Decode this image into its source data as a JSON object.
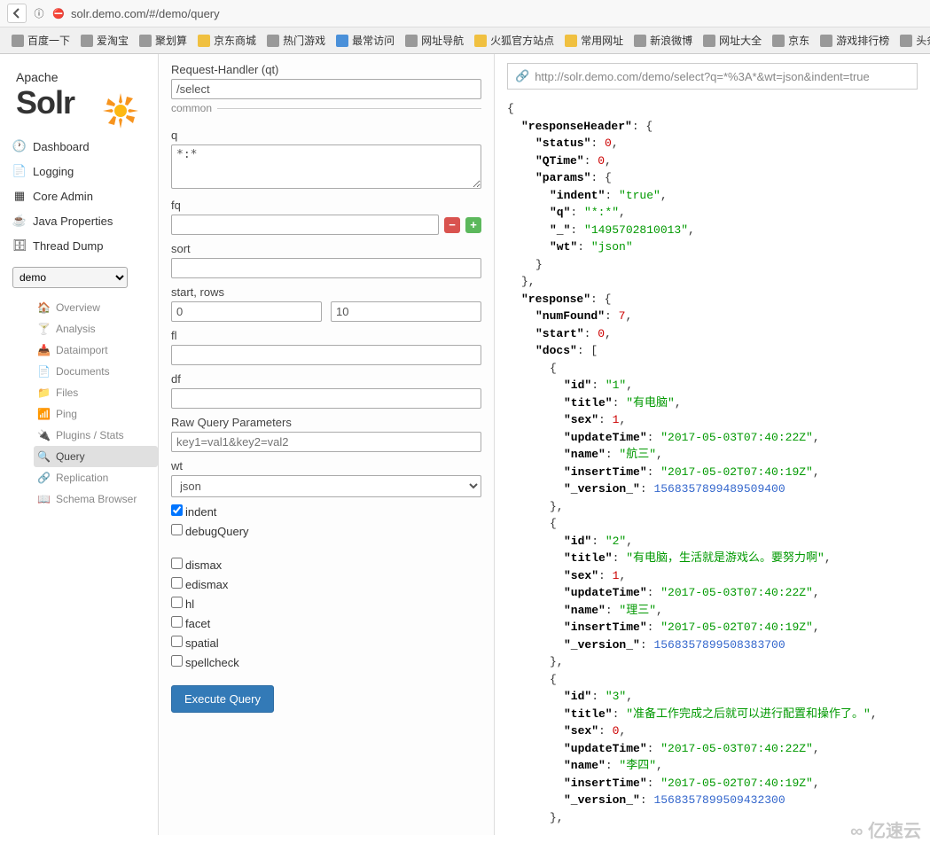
{
  "browser": {
    "url": "solr.demo.com/#/demo/query",
    "bookmarks": [
      "百度一下",
      "爱淘宝",
      "聚划算",
      "京东商城",
      "热门游戏",
      "最常访问",
      "网址导航",
      "火狐官方站点",
      "常用网址",
      "新浪微博",
      "网址大全",
      "京东",
      "游戏排行榜",
      "头条新"
    ]
  },
  "logo": {
    "apache": "Apache",
    "solr": "Solr"
  },
  "nav": {
    "dashboard": "Dashboard",
    "logging": "Logging",
    "coreadmin": "Core Admin",
    "javaprops": "Java Properties",
    "threaddump": "Thread Dump"
  },
  "core_selector": "demo",
  "core_nav": {
    "overview": "Overview",
    "analysis": "Analysis",
    "dataimport": "Dataimport",
    "documents": "Documents",
    "files": "Files",
    "ping": "Ping",
    "plugins": "Plugins / Stats",
    "query": "Query",
    "replication": "Replication",
    "schema": "Schema Browser"
  },
  "form": {
    "qt_label": "Request-Handler (qt)",
    "qt_value": "/select",
    "common_label": "common",
    "q_label": "q",
    "q_value": "*:*",
    "fq_label": "fq",
    "sort_label": "sort",
    "startrows_label": "start, rows",
    "start_value": "0",
    "rows_value": "10",
    "fl_label": "fl",
    "df_label": "df",
    "raw_label": "Raw Query Parameters",
    "raw_placeholder": "key1=val1&key2=val2",
    "wt_label": "wt",
    "wt_value": "json",
    "indent_label": "indent",
    "debug_label": "debugQuery",
    "dismax_label": "dismax",
    "edismax_label": "edismax",
    "hl_label": "hl",
    "facet_label": "facet",
    "spatial_label": "spatial",
    "spellcheck_label": "spellcheck",
    "execute": "Execute Query"
  },
  "response": {
    "url": "http://solr.demo.com/demo/select?q=*%3A*&wt=json&indent=true",
    "header": {
      "status": 0,
      "QTime": 0,
      "params": {
        "indent": "true",
        "q": "*:*",
        "_": "1495702810013",
        "wt": "json"
      }
    },
    "body": {
      "numFound": 7,
      "start": 0,
      "docs": [
        {
          "id": "1",
          "title": "有电脑",
          "sex": 1,
          "updateTime": "2017-05-03T07:40:22Z",
          "name": "航三",
          "insertTime": "2017-05-02T07:40:19Z",
          "_version_": "1568357899489509400"
        },
        {
          "id": "2",
          "title": "有电脑，生活就是游戏么。要努力啊",
          "sex": 1,
          "updateTime": "2017-05-03T07:40:22Z",
          "name": "理三",
          "insertTime": "2017-05-02T07:40:19Z",
          "_version_": "1568357899508383700"
        },
        {
          "id": "3",
          "title": "准备工作完成之后就可以进行配置和操作了。",
          "sex": 0,
          "updateTime": "2017-05-03T07:40:22Z",
          "name": "李四",
          "insertTime": "2017-05-02T07:40:19Z",
          "_version_": "1568357899509432300"
        }
      ]
    }
  },
  "watermark": "亿速云"
}
